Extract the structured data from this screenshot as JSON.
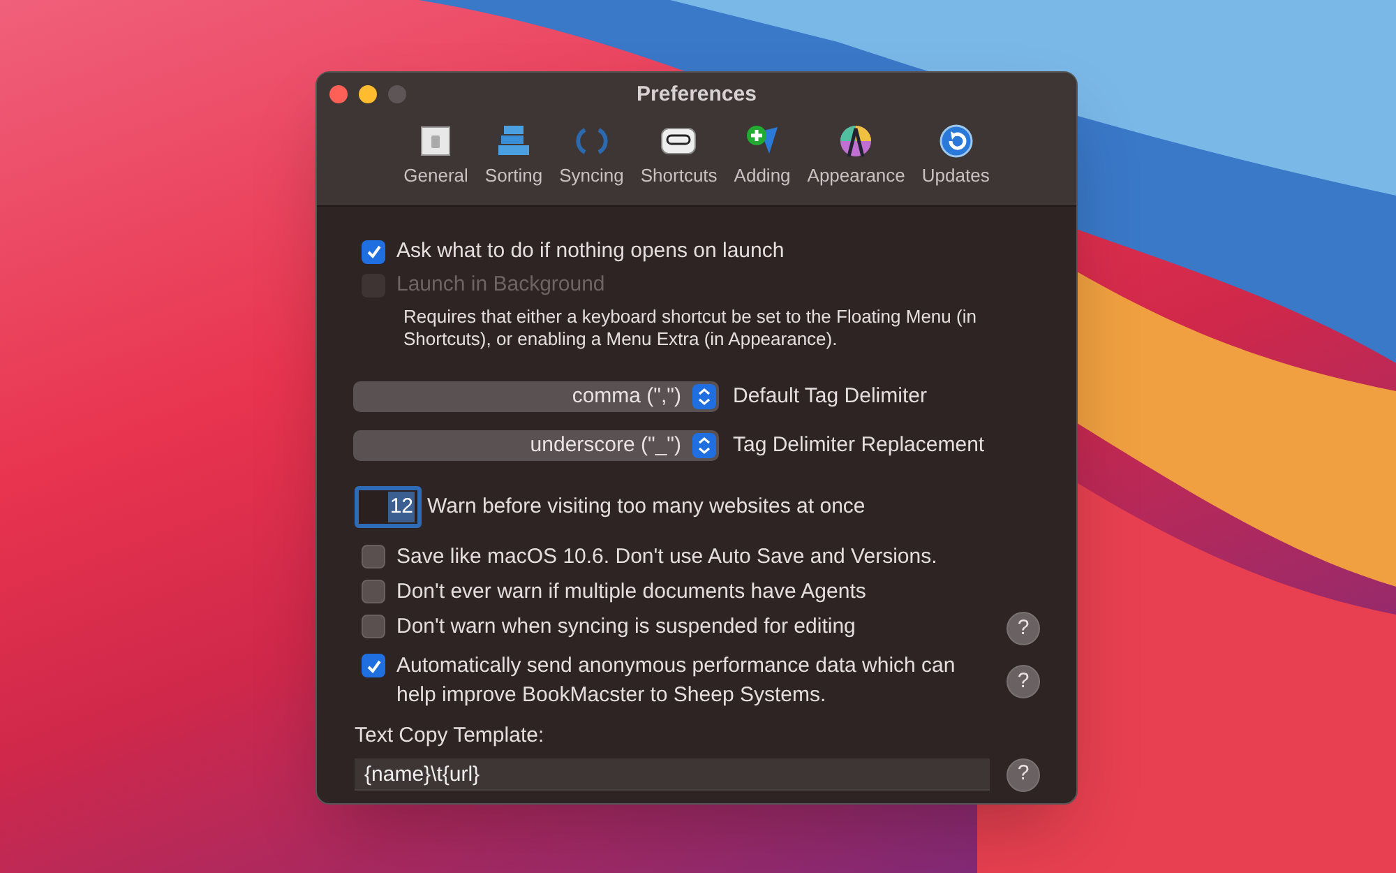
{
  "window": {
    "title": "Preferences"
  },
  "toolbar": [
    {
      "label": "General",
      "kind": "switch"
    },
    {
      "label": "Sorting",
      "kind": "stack"
    },
    {
      "label": "Syncing",
      "kind": "sync"
    },
    {
      "label": "Shortcuts",
      "kind": "key"
    },
    {
      "label": "Adding",
      "kind": "add"
    },
    {
      "label": "Appearance",
      "kind": "palette"
    },
    {
      "label": "Updates",
      "kind": "update"
    }
  ],
  "launch_options": [
    {
      "label": "Ask what to do if nothing opens on launch",
      "checked": true,
      "disabled": false
    },
    {
      "label": "Launch in Background",
      "checked": false,
      "disabled": true
    }
  ],
  "launch_note": "Requires that either a keyboard shortcut be set to the Floating Menu (in Shortcuts), or enabling a Menu Extra (in Appearance).",
  "popups": [
    {
      "value": "comma (\",\")",
      "label": "Default Tag Delimiter"
    },
    {
      "value": "underscore (\"_\")",
      "label": "Tag Delimiter Replacement"
    }
  ],
  "warn_count": {
    "value": "12",
    "label": "Warn before visiting too many websites at once"
  },
  "options": [
    {
      "label": "Save like macOS 10.6.  Don't use Auto Save and Versions.",
      "checked": false,
      "help": false
    },
    {
      "label": "Don't ever warn if multiple documents have Agents",
      "checked": false,
      "help": false
    },
    {
      "label": "Don't warn when syncing is suspended for editing",
      "checked": false,
      "help": true
    },
    {
      "label": "Automatically send anonymous performance data which can help improve BookMacster to Sheep Systems.",
      "checked": true,
      "help": true
    }
  ],
  "template": {
    "label": "Text Copy Template:",
    "value": "{name}\\t{url}",
    "help": true
  },
  "help_glyph": "?"
}
